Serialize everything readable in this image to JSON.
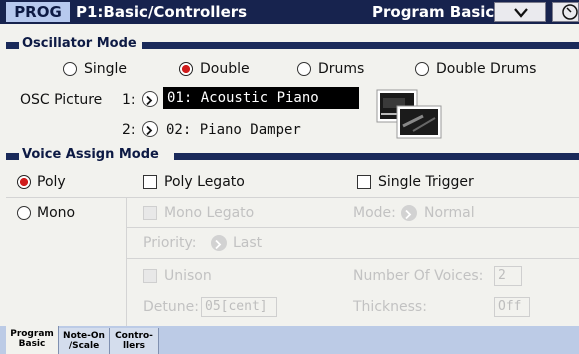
{
  "header": {
    "mode": "PROG",
    "page_title": "P1:Basic/Controllers",
    "page_name": "Program Basic"
  },
  "oscillator_mode": {
    "title": "Oscillator Mode",
    "options": [
      {
        "label": "Single",
        "selected": false
      },
      {
        "label": "Double",
        "selected": true
      },
      {
        "label": "Drums",
        "selected": false
      },
      {
        "label": "Double Drums",
        "selected": false
      }
    ],
    "osc_picture_label": "OSC Picture",
    "osc1_index": "1:",
    "osc1_value": "01: Acoustic Piano",
    "osc2_index": "2:",
    "osc2_value": "02: Piano Damper"
  },
  "voice_assign_mode": {
    "title": "Voice Assign Mode",
    "poly_label": "Poly",
    "poly_selected": true,
    "mono_label": "Mono",
    "poly_legato_label": "Poly Legato",
    "single_trigger_label": "Single Trigger",
    "mono_legato_label": "Mono Legato",
    "mode_label": "Mode:",
    "mode_value": "Normal",
    "priority_label": "Priority:",
    "priority_value": "Last",
    "unison_label": "Unison",
    "number_of_voices_label": "Number Of Voices:",
    "number_of_voices_value": "2",
    "detune_label": "Detune:",
    "detune_value": "05[cent]",
    "thickness_label": "Thickness:",
    "thickness_value": "Off"
  },
  "tabs": [
    {
      "line1": "Program",
      "line2": "Basic",
      "active": true
    },
    {
      "line1": "Note-On",
      "line2": "/Scale",
      "active": false
    },
    {
      "line1": "Contro-",
      "line2": "llers",
      "active": false
    }
  ],
  "colors": {
    "header_bg": "#17234e",
    "selected_radio": "#d01c1c",
    "footer_bg": "#bccbe6"
  }
}
